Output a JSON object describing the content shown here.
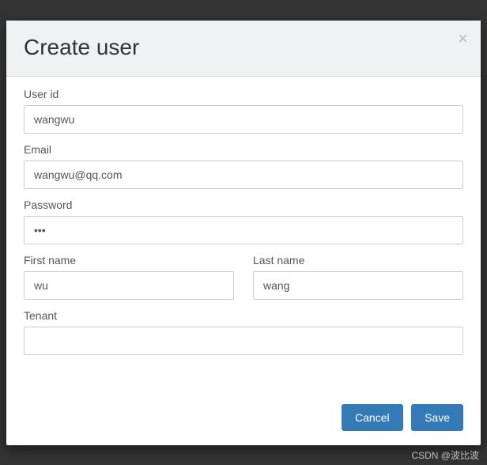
{
  "modal": {
    "title": "Create user",
    "close_icon": "×"
  },
  "form": {
    "user_id": {
      "label": "User id",
      "value": "wangwu"
    },
    "email": {
      "label": "Email",
      "value": "wangwu@qq.com"
    },
    "password": {
      "label": "Password",
      "value": "•••"
    },
    "first_name": {
      "label": "First name",
      "value": "wu"
    },
    "last_name": {
      "label": "Last name",
      "value": "wang"
    },
    "tenant": {
      "label": "Tenant",
      "value": ""
    }
  },
  "footer": {
    "cancel_label": "Cancel",
    "save_label": "Save"
  },
  "watermark": "CSDN @波比波"
}
